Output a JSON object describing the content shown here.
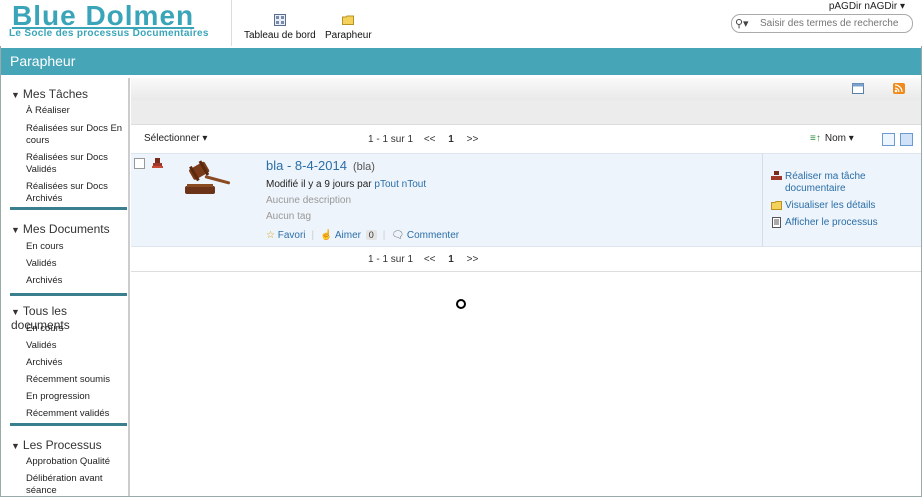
{
  "header": {
    "logo": "Blue Dolmen",
    "tagline": "Le Socle des processus Documentaires",
    "nav": [
      {
        "label": "Tableau de bord",
        "icon": "dashboard-icon"
      },
      {
        "label": "Parapheur",
        "icon": "folder-icon"
      }
    ],
    "user": "pAGDir nAGDir",
    "search_placeholder": "Saisir des termes de recherche"
  },
  "page_title": "Parapheur",
  "sidebar": {
    "sections": [
      {
        "title": "Mes Tâches",
        "items": [
          "À Réaliser",
          "Réalisées sur Docs En cours",
          "Réalisées sur Docs Validés",
          "Réalisées sur Docs Archivés"
        ]
      },
      {
        "title": "Mes Documents",
        "items": [
          "En cours",
          "Validés",
          "Archivés"
        ]
      },
      {
        "title": "Tous les documents",
        "items": [
          "En cours",
          "Validés",
          "Archivés",
          "Récemment soumis",
          "En progression",
          "Récemment validés"
        ]
      },
      {
        "title": "Les Processus",
        "items": [
          "Approbation Qualité",
          "Délibération avant séance"
        ]
      }
    ]
  },
  "list": {
    "select_label": "Sélectionner",
    "pager_text": "1 - 1 sur 1",
    "prev": "<<",
    "page": "1",
    "next": ">>",
    "sort_label": "Nom"
  },
  "document": {
    "title": "bla - 8-4-2014",
    "subtitle": "(bla)",
    "modified_prefix": "Modifié il y a 9 jours par",
    "modified_by": "pTout nTout",
    "description": "Aucune description",
    "tags": "Aucun tag",
    "favorite": "Favori",
    "like": "Aimer",
    "like_count": "0",
    "comment": "Commenter",
    "actions": [
      "Réaliser ma tâche documentaire",
      "Visualiser les détails",
      "Afficher le processus"
    ]
  }
}
